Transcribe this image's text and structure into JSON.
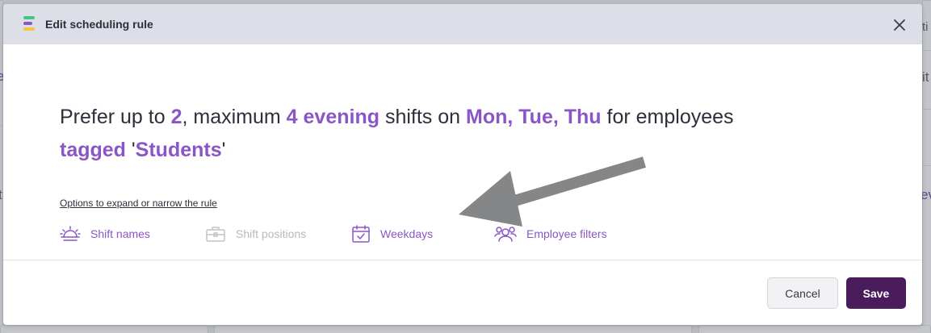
{
  "colors": {
    "accent": "#8a56c7",
    "save_button": "#4a1c5c",
    "header_bg": "#dddfe8",
    "disabled": "#b9b8be",
    "logo_bars": [
      "#3ec97f",
      "#8a56c7",
      "#f7c43a"
    ]
  },
  "background": {
    "fragments": [
      "e",
      "t",
      "ti",
      "it",
      "ev"
    ]
  },
  "modal": {
    "title": "Edit scheduling rule",
    "close_icon": "close-icon"
  },
  "rule": {
    "p1": "Prefer up to ",
    "v1": "2",
    "p2": ", maximum ",
    "v2": "4 evening",
    "p3": " shifts on ",
    "v3": "Mon, Tue, Thu",
    "p4": " for employees ",
    "v4": "tagged",
    "p5": " '",
    "v5": "Students",
    "p6": "'"
  },
  "options": {
    "link": "Options to expand or narrow the rule",
    "items": [
      {
        "label": "Shift names",
        "icon": "sunrise-icon",
        "enabled": true
      },
      {
        "label": "Shift positions",
        "icon": "briefcase-icon",
        "enabled": false
      },
      {
        "label": "Weekdays",
        "icon": "calendar-check-icon",
        "enabled": true
      },
      {
        "label": "Employee filters",
        "icon": "users-icon",
        "enabled": true
      }
    ]
  },
  "footer": {
    "cancel": "Cancel",
    "save": "Save"
  }
}
